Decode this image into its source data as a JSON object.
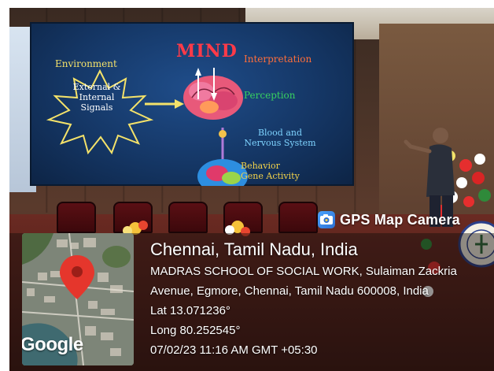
{
  "slide": {
    "title": "MIND",
    "environment": "Environment",
    "burst_line1": "External &",
    "burst_line2": "Internal",
    "burst_line3": "Signals",
    "interpretation": "Interpretation",
    "perception": "Perception",
    "blood_line1": "Blood and",
    "blood_line2": "Nervous System",
    "behavior_line1": "Behavior",
    "behavior_line2": "Gene Activity"
  },
  "gps": {
    "app_name": "GPS Map Camera",
    "city": "Chennai, Tamil Nadu, India",
    "address_line1": "MADRAS SCHOOL OF SOCIAL WORK, Sulaiman Zackria",
    "address_line2": "Avenue, Egmore, Chennai, Tamil Nadu 600008, India",
    "lat": "Lat 13.071236°",
    "long": "Long 80.252545°",
    "datetime": "07/02/23 11:16 AM GMT +05:30",
    "map_provider": "Google",
    "pin_color": "#e5362c"
  },
  "icons": {
    "map_pin": "map-pin-icon",
    "camera": "gps-camera-icon"
  }
}
